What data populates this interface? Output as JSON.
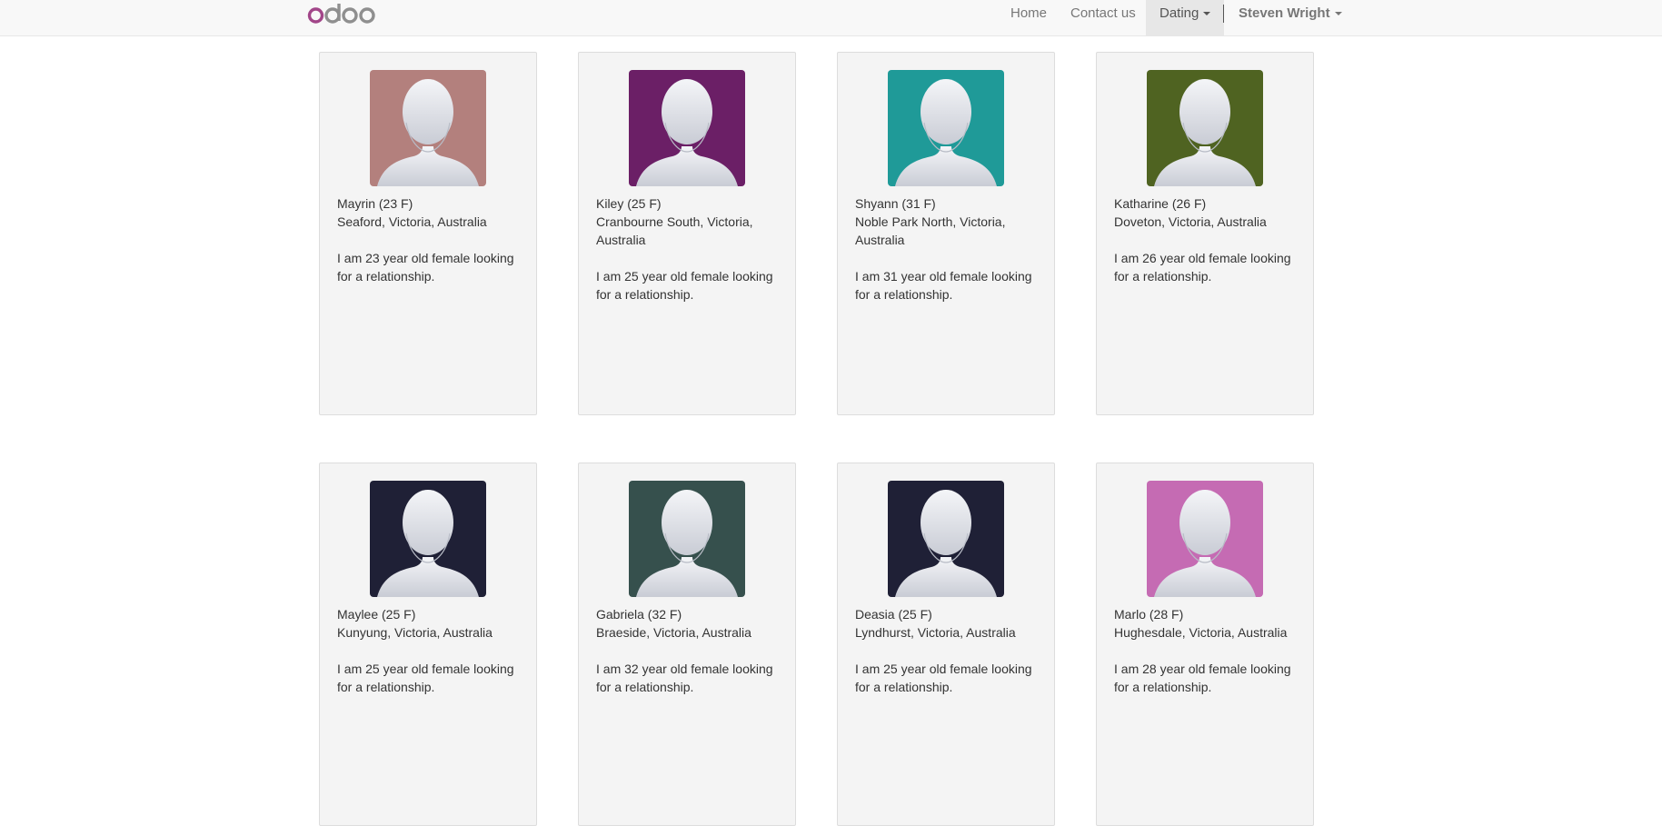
{
  "nav": {
    "logo_alt": "odoo",
    "home": "Home",
    "contact": "Contact us",
    "dating": "Dating",
    "user": "Steven Wright"
  },
  "profiles": [
    {
      "name_age": "Mayrin (23 F)",
      "location": "Seaford, Victoria, Australia",
      "bio": "I am 23 year old female looking for a relationship.",
      "avatar_color": "#b3807d"
    },
    {
      "name_age": "Kiley (25 F)",
      "location": "Cranbourne South, Victoria, Australia",
      "bio": "I am 25 year old female looking for a relationship.",
      "avatar_color": "#6b1f66"
    },
    {
      "name_age": "Shyann (31 F)",
      "location": "Noble Park North, Victoria, Australia",
      "bio": "I am 31 year old female looking for a relationship.",
      "avatar_color": "#1f9a98"
    },
    {
      "name_age": "Katharine (26 F)",
      "location": "Doveton, Victoria, Australia",
      "bio": "I am 26 year old female looking for a relationship.",
      "avatar_color": "#4f6321"
    },
    {
      "name_age": "Maylee (25 F)",
      "location": "Kunyung, Victoria, Australia",
      "bio": "I am 25 year old female looking for a relationship.",
      "avatar_color": "#1f2036"
    },
    {
      "name_age": "Gabriela (32 F)",
      "location": "Braeside, Victoria, Australia",
      "bio": "I am 32 year old female looking for a relationship.",
      "avatar_color": "#36504d"
    },
    {
      "name_age": "Deasia (25 F)",
      "location": "Lyndhurst, Victoria, Australia",
      "bio": "I am 25 year old female looking for a relationship.",
      "avatar_color": "#1f2036"
    },
    {
      "name_age": "Marlo (28 F)",
      "location": "Hughesdale, Victoria, Australia",
      "bio": "I am 28 year old female looking for a relationship.",
      "avatar_color": "#c56bb3"
    }
  ]
}
